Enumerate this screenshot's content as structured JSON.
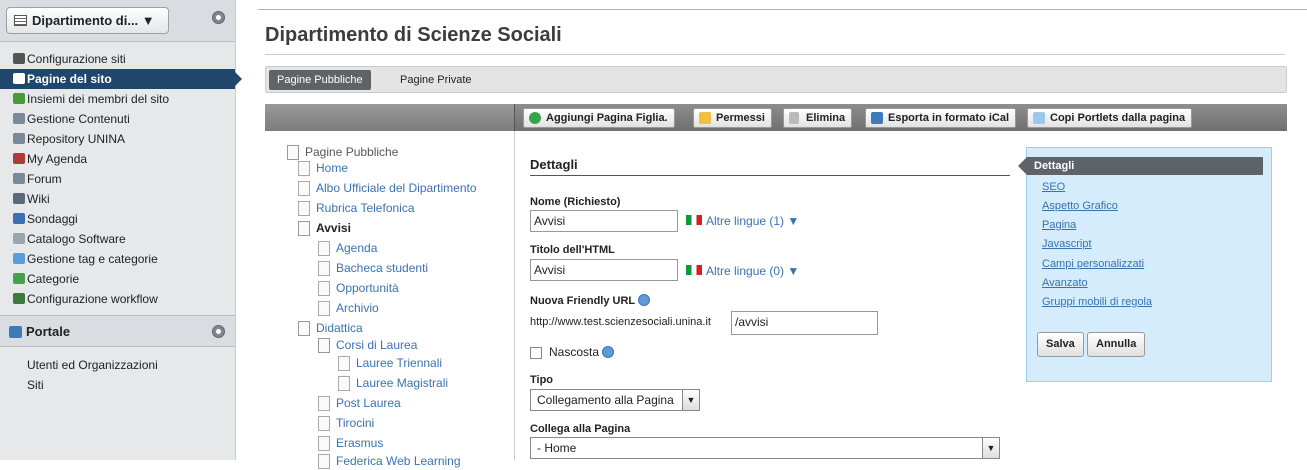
{
  "sidebar": {
    "site_selector": "Dipartimento di... ▼",
    "items": [
      {
        "label": "Configurazione siti",
        "icon": "gear-icon",
        "color": "#555555"
      },
      {
        "label": "Pagine del sito",
        "icon": "pages-icon",
        "color": "#ffffff"
      },
      {
        "label": "Insiemi dei membri del sito",
        "icon": "users-icon",
        "color": "#4a9a3a"
      },
      {
        "label": "Gestione Contenuti",
        "icon": "content-icon",
        "color": "#7a8a9a"
      },
      {
        "label": "Repository UNINA",
        "icon": "repository-icon",
        "color": "#7a8a9a"
      },
      {
        "label": "My Agenda",
        "icon": "calendar-icon",
        "color": "#b03a3a"
      },
      {
        "label": "Forum",
        "icon": "forum-icon",
        "color": "#7a8a9a"
      },
      {
        "label": "Wiki",
        "icon": "wiki-icon",
        "color": "#5a6a7a"
      },
      {
        "label": "Sondaggi",
        "icon": "poll-icon",
        "color": "#3d6fb0"
      },
      {
        "label": "Catalogo Software",
        "icon": "software-icon",
        "color": "#9aa4ae"
      },
      {
        "label": "Gestione tag e categorie",
        "icon": "tag-icon",
        "color": "#5d9bd9"
      },
      {
        "label": "Categorie",
        "icon": "categories-icon",
        "color": "#4aa04a"
      },
      {
        "label": "Configurazione workflow",
        "icon": "workflow-icon",
        "color": "#3a7a3a"
      }
    ],
    "section_portale": "Portale",
    "portale_items": [
      {
        "label": "Utenti ed Organizzazioni",
        "icon": "user-icon",
        "color": "#e0a020"
      },
      {
        "label": "Siti",
        "icon": "sites-icon",
        "color": "#3d6fb0"
      }
    ]
  },
  "main": {
    "title": "Dipartimento di Scienze Sociali",
    "tabs": [
      "Pagine Pubbliche",
      "Pagine Private"
    ],
    "toolbar": {
      "add_child": "Aggiungi Pagina Figlia.",
      "permissions": "Permessi",
      "delete": "Elimina",
      "export_ical": "Esporta in formato iCal",
      "copy_portlets": "Copi Portlets dalla pagina"
    },
    "tree": [
      "Pagine Pubbliche",
      "Home",
      "Albo Ufficiale del Dipartimento",
      "Rubrica Telefonica",
      "Avvisi",
      "Agenda",
      "Bacheca studenti",
      "Opportunità",
      "Archivio",
      "Didattica",
      "Corsi di Laurea",
      "Lauree Triennali",
      "Lauree Magistrali",
      "Post Laurea",
      "Tirocini",
      "Erasmus",
      "Federica Web Learning"
    ],
    "details": {
      "header": "Dettagli",
      "name_label": "Nome (Richiesto)",
      "name_value": "Avvisi",
      "name_languages": "Altre lingue (1) ▼",
      "html_title_label": "Titolo dell'HTML",
      "html_title_value": "Avvisi",
      "html_title_languages": "Altre lingue (0) ▼",
      "friendly_url_label": "Nuova Friendly URL",
      "url_prefix": "http://www.test.scienzesociali.unina.it",
      "url_value": "/avvisi",
      "hidden_label": "Nascosta",
      "type_label": "Tipo",
      "type_value": "Collegamento alla Pagina",
      "link_label": "Collega alla Pagina",
      "link_value": "- Home"
    },
    "nav": {
      "current": "Dettagli",
      "links": [
        "SEO",
        "Aspetto Grafico",
        "Pagina",
        "Javascript",
        "Campi personalizzati",
        "Avanzato",
        "Gruppi mobili di regola"
      ],
      "save": "Salva",
      "cancel": "Annulla"
    }
  }
}
